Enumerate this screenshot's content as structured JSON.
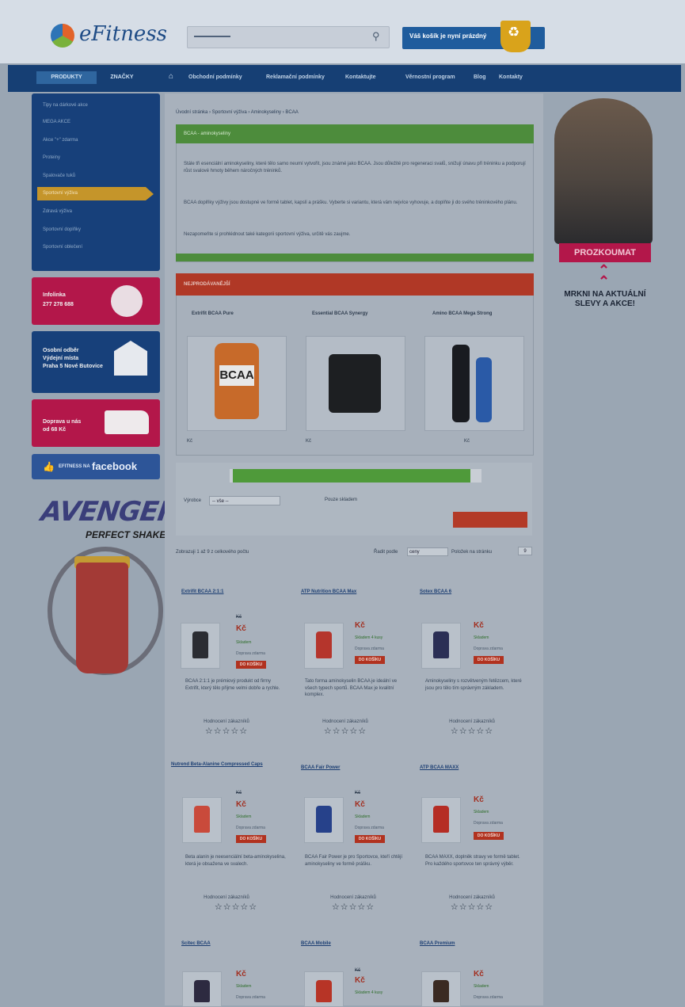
{
  "header": {
    "logo": "eFitness",
    "cart_label": "Váš košík je nyní prázdný"
  },
  "nav": {
    "tabs": [
      "PRODUKTY",
      "ZNAČKY"
    ],
    "links": [
      "Obchodní podmínky",
      "Reklamační podmínky",
      "Kontaktujte",
      "Věrnostní program",
      "Blog",
      "Kontakty"
    ]
  },
  "sidebar": {
    "categories": [
      "Tipy na dárkové akce",
      "MEGA AKCE",
      "Akce \"+\" zdarma",
      "Proteiny",
      "Spalovače tuků",
      "Sportovní výživa",
      "Zdravá výživa",
      "Sportovní doplňky",
      "Sportovní oblečení"
    ],
    "infoline": {
      "title": "Infolinka",
      "phone": "277 278 688"
    },
    "pickup": {
      "line1": "Osobní odběr",
      "line2": "Výdejní místa",
      "line3": "Praha 5 Nové Butovice"
    },
    "delivery": {
      "line1": "Doprava u nás",
      "line2": "od 68 Kč"
    },
    "facebook": {
      "prefix": "EFITNESS NA",
      "brand": "facebook"
    },
    "promo": {
      "title": "AVENGERS",
      "subtitle": "PERFECT SHAKER"
    }
  },
  "main": {
    "breadcrumb": "Úvodní stránka › Sportovní výživa › Aminokyseliny › BCAA",
    "intro": {
      "heading": "BCAA - aminokyseliny",
      "p1": "Stále tři esenciální aminokyseliny, které tělo samo neumí vytvořit, jsou známé jako BCAA. Jsou důležité pro regeneraci svalů, snižují únavu při tréninku a podporují růst svalové hmoty během náročných tréninků.",
      "p2": "BCAA doplňky výživy jsou dostupné ve formě tablet, kapslí a prášku. Vyberte si variantu, která vám nejvíce vyhovuje, a doplňte ji do svého tréninkového plánu.",
      "p3": "Nezapomeňte si prohlédnout také kategorii sportovní výživa, určitě vás zaujme."
    },
    "bestsellers": {
      "heading": "NEJPRODÁVANĚJŠÍ",
      "items": [
        {
          "name": "Extrifit BCAA Pure",
          "price": "Kč"
        },
        {
          "name": "Essential BCAA Synergy",
          "price": "Kč"
        },
        {
          "name": "Amino BCAA Mega Strong",
          "price": "Kč"
        }
      ]
    },
    "filter": {
      "label": "Výrobce",
      "select": "-- vše --",
      "checkbox": "Pouze skladem"
    },
    "listing": {
      "count": "Zobrazuji 1 až 9 z celkového počtu",
      "sort_label": "Řadit podle",
      "sort_value": "ceny",
      "per_page_label": "Položek na stránku",
      "per_page_value": "9"
    },
    "products": [
      {
        "name": "Extrifit BCAA 2:1:1",
        "old": "Kč",
        "price": "Kč",
        "stock": "Skladem",
        "delivery": "Doprava zdarma",
        "button": "DO KOŠÍKU",
        "desc": "BCAA 2:1:1 je prémiový produkt od firmy Extrifit, který tělo přijme velmi dobře a rychle.",
        "rating": "Hodnocení zákazníků",
        "stars": "☆☆☆☆☆"
      },
      {
        "name": "ATP Nutrition BCAA Max",
        "old": "",
        "price": "Kč",
        "stock": "Skladem 4 kusy",
        "delivery": "Doprava zdarma",
        "button": "DO KOŠÍKU",
        "desc": "Tato forma aminokyselin BCAA je ideální ve všech typech sportů. BCAA Max je kvalitní komplex.",
        "rating": "Hodnocení zákazníků",
        "stars": "☆☆☆☆☆"
      },
      {
        "name": "Sotex BCAA 6",
        "old": "",
        "price": "Kč",
        "stock": "Skladem",
        "delivery": "Doprava zdarma",
        "button": "DO KOŠÍKU",
        "desc": "Aminokyseliny s rozvětveným řetězcem, které jsou pro tělo tím správným základem.",
        "rating": "Hodnocení zákazníků",
        "stars": "☆☆☆☆☆"
      },
      {
        "name": "Nutrend Beta-Alanine Compressed Caps",
        "old": "Kč",
        "price": "Kč",
        "stock": "Skladem",
        "delivery": "Doprava zdarma",
        "button": "DO KOŠÍKU",
        "desc": "Beta alanin je neesenciální beta-aminokyselina, která je obsažena ve svalech.",
        "rating": "Hodnocení zákazníků",
        "stars": "☆☆☆☆☆"
      },
      {
        "name": "BCAA Fair Power",
        "old": "Kč",
        "price": "Kč",
        "stock": "Skladem",
        "delivery": "Doprava zdarma",
        "button": "DO KOŠÍKU",
        "desc": "BCAA Fair Power je pro Sportovce, kteří chtějí aminokyseliny ve formě prášku.",
        "rating": "Hodnocení zákazníků",
        "stars": "☆☆☆☆☆"
      },
      {
        "name": "ATP BCAA MAXX",
        "old": "",
        "price": "Kč",
        "stock": "Skladem",
        "delivery": "Doprava zdarma",
        "button": "DO KOŠÍKU",
        "desc": "BCAA MAXX, doplněk stravy ve formě tablet. Pro každého sportovce ten správný výběr.",
        "rating": "Hodnocení zákazníků",
        "stars": "☆☆☆☆☆"
      },
      {
        "name": "Scitec BCAA",
        "old": "",
        "price": "Kč",
        "stock": "Skladem",
        "delivery": "Doprava zdarma"
      },
      {
        "name": "BCAA Mobile",
        "old": "Kč",
        "price": "Kč",
        "stock": "Skladem 4 kusy",
        "delivery": ""
      },
      {
        "name": "BCAA Premium",
        "old": "",
        "price": "Kč",
        "stock": "Skladem",
        "delivery": "Doprava zdarma"
      }
    ]
  },
  "banner": {
    "button": "PROZKOUMAT",
    "text": "MRKNI NA AKTUÁLNÍ SLEVY A AKCE!"
  },
  "colors": {
    "accent_red": "#b03826",
    "brand_blue": "#17407a",
    "green": "#4d8c3c",
    "pink": "#b3174a"
  }
}
